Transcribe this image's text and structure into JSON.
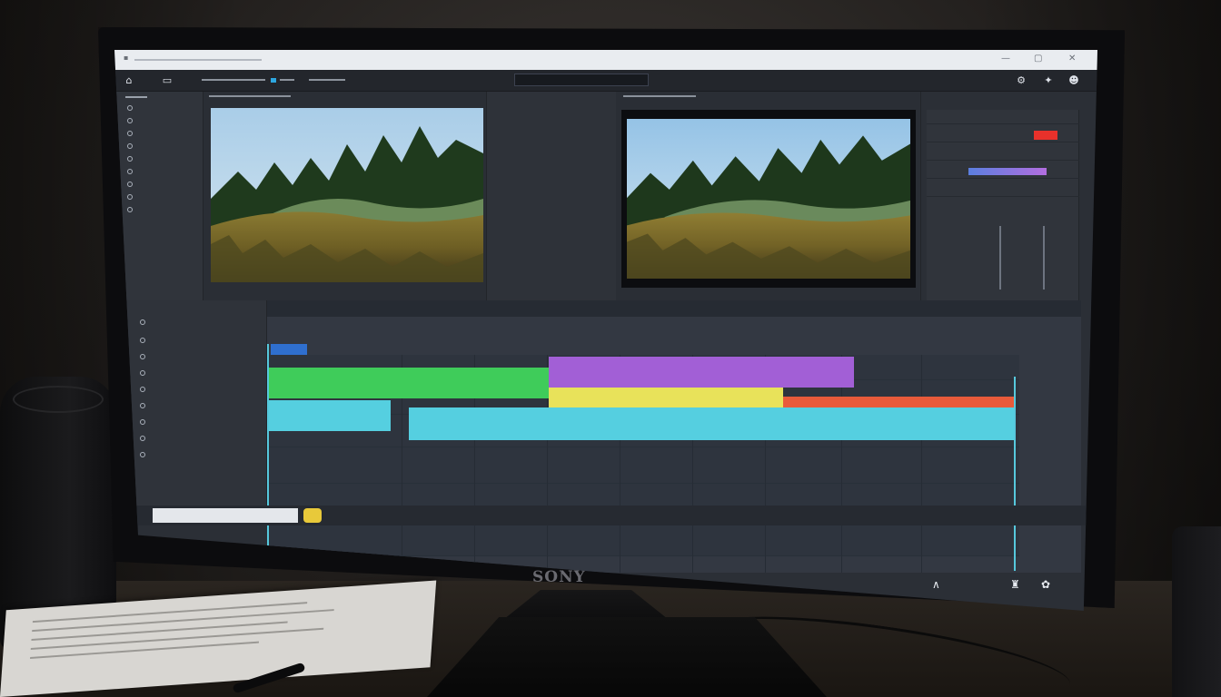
{
  "scene": {
    "monitor_brand": "SONY"
  },
  "app": {
    "colors": {
      "clip_purple": "#a25fd6",
      "clip_green": "#3fcc5a",
      "clip_yellow": "#e8e25a",
      "clip_red": "#e85a3a",
      "clip_cyan": "#55cfe0",
      "swatch_red": "#e8312b",
      "playhead": "#56c8dc"
    },
    "icons": [
      "gear-icon",
      "puzzle-icon",
      "bell-icon",
      "user-icon",
      "close-icon",
      "minimize-icon",
      "maximize-icon"
    ]
  }
}
